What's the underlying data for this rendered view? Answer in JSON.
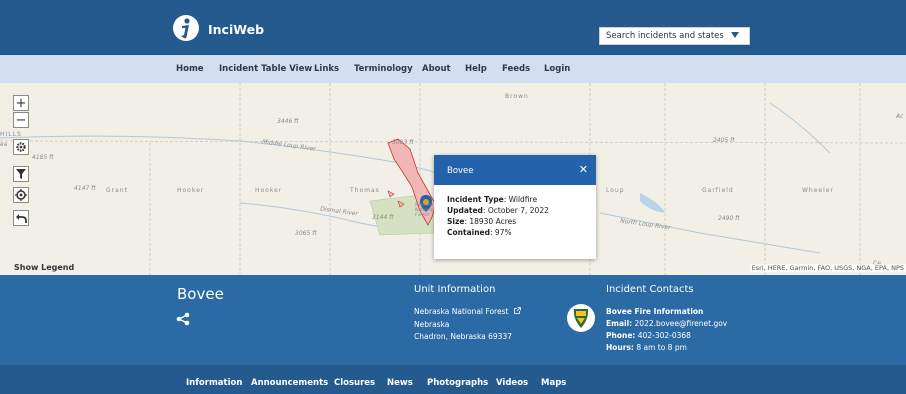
{
  "header": {
    "brand": "InciWeb",
    "search": {
      "placeholder": "Search incidents and states"
    }
  },
  "nav": {
    "items": [
      "Home",
      "Incident Table View",
      "Links",
      "Terminology",
      "About",
      "Help",
      "Feeds",
      "Login"
    ]
  },
  "map": {
    "controls": {
      "zoom_in": "+",
      "zoom_out": "−"
    },
    "labels": {
      "brown": "Brown",
      "elev_3446": "3446 ft",
      "elev_3083": "3083 ft",
      "elev_4185": "4185 ft",
      "elev_4147": "4147 ft",
      "grant": "Grant",
      "hooker_1": "Hooker",
      "hooker_2": "Hooker",
      "thomas": "Thomas",
      "elev_3144": "3144 ft",
      "elev_3065": "3065 ft",
      "middle_loup": "Middle Loup River",
      "dismal": "Dismal River",
      "nebraska_forest": "Nebraska National Forest",
      "loup": "Loup",
      "garfield": "Garfield",
      "wheeler": "Wheeler",
      "elev_2405": "2405 ft",
      "elev_2490": "2490 ft",
      "north_loup": "North Loup River",
      "hills": "HILLS",
      "ce": "Ce",
      "ac": "Ac",
      "ea": "ea"
    },
    "show_legend": "Show Legend",
    "attribution": "Esri, HERE, Garmin, FAO, USGS, NGA, EPA, NPS"
  },
  "popup": {
    "title": "Bovee",
    "close": "✕",
    "incident_type_label": "Incident Type",
    "incident_type": ": Wildfire",
    "updated_label": "Updated",
    "updated": ": October 7, 2022",
    "size_label": "Size",
    "size": ": 18930 Acres",
    "contained_label": "Contained",
    "contained": ": 97%"
  },
  "incident": {
    "title": "Bovee",
    "unit_heading": "Unit Information",
    "unit_name": "Nebraska National Forest",
    "unit_state": "Nebraska",
    "unit_address": "Chadron, Nebraska 69337",
    "contacts_heading": "Incident Contacts",
    "contact_name": "Bovee Fire Information",
    "email_label": "Email:",
    "email": " 2022.bovee@firenet.gov",
    "phone_label": "Phone:",
    "phone": " 402-302-0368",
    "hours_label": "Hours:",
    "hours": " 8 am to 8 pm"
  },
  "subnav": {
    "items": [
      "Information",
      "Announcements",
      "Closures",
      "News",
      "Photographs",
      "Videos",
      "Maps"
    ]
  },
  "colors": {
    "header": "#245a8e",
    "nav": "#d2dff0",
    "incident_band": "#2c6aa5",
    "popup_header": "#2463ac",
    "fire_perimeter": "#f2b6b6"
  }
}
